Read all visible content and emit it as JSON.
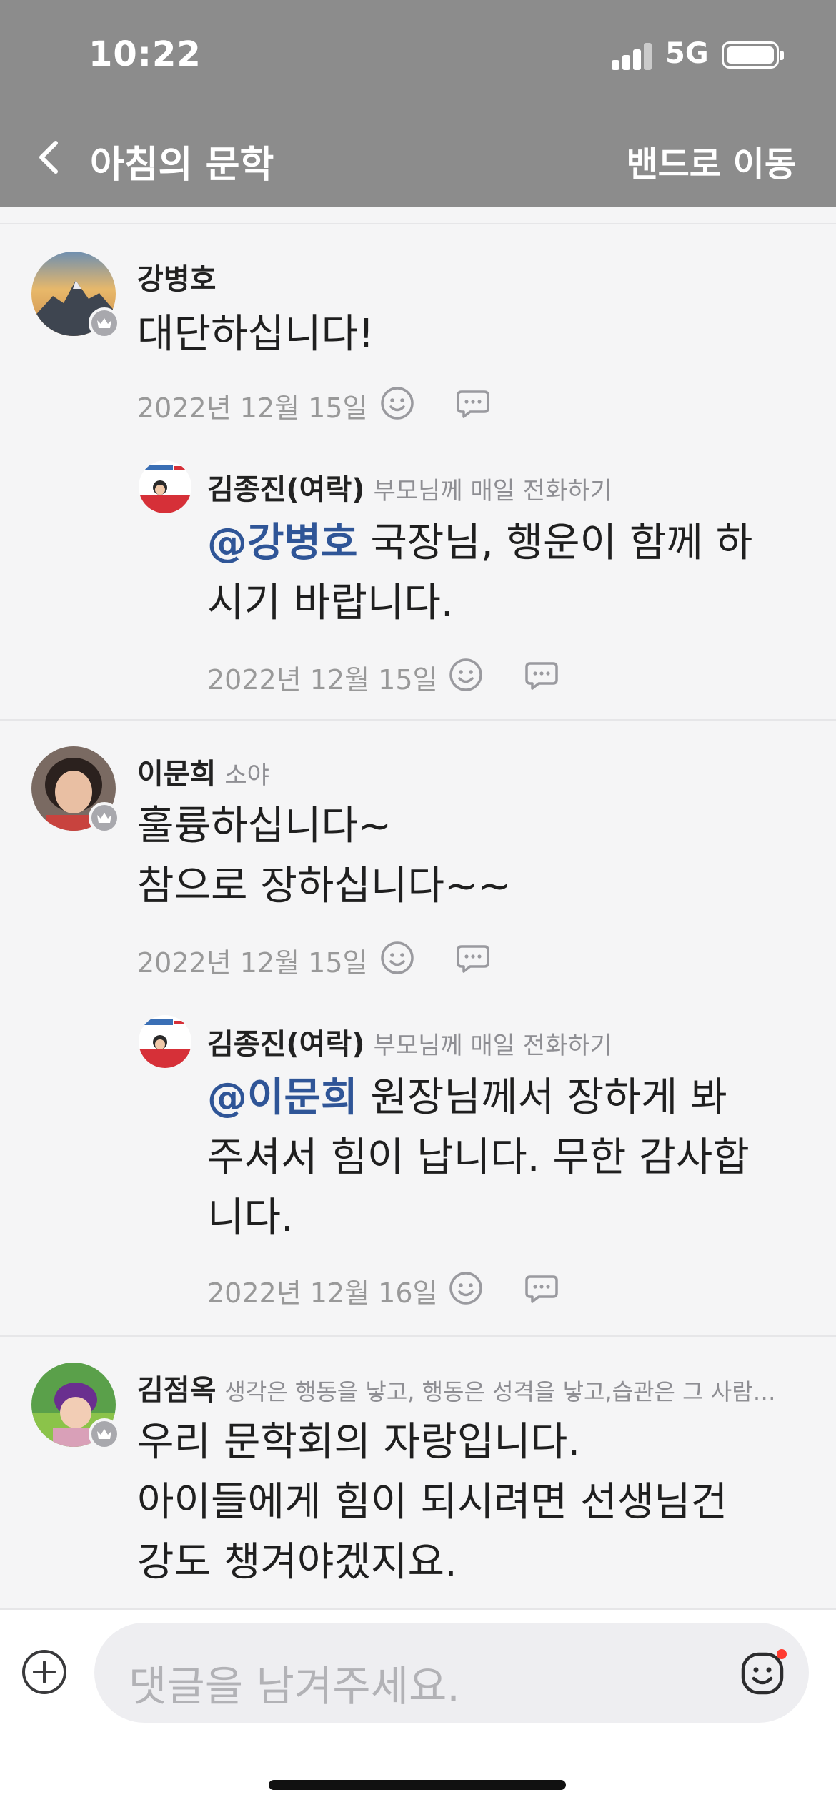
{
  "status_bar": {
    "time": "10:22",
    "network": "5G"
  },
  "nav": {
    "title": "아침의 문학",
    "action": "밴드로 이동"
  },
  "comments": [
    {
      "author": "강병호",
      "description": "",
      "text_lines": [
        "대단하십니다!"
      ],
      "date": "2022년 12월 15일",
      "replies": [
        {
          "author": "김종진(여락)",
          "description": "부모님께 매일 전화하기",
          "mention": "@강병호",
          "text_first": " 국장님, 행운이 함께 하",
          "text_lines": [
            "시기 바랍니다."
          ],
          "date": "2022년 12월 15일"
        }
      ]
    },
    {
      "author": "이문희",
      "description": "소야",
      "text_lines": [
        "훌륭하십니다~",
        "참으로 장하십니다~~"
      ],
      "date": "2022년 12월 15일",
      "replies": [
        {
          "author": "김종진(여락)",
          "description": "부모님께 매일 전화하기",
          "mention": "@이문희",
          "text_first": " 원장님께서 장하게 봐",
          "text_lines": [
            "주셔서 힘이 납니다. 무한 감사합",
            "니다."
          ],
          "date": "2022년 12월 16일"
        }
      ]
    },
    {
      "author": "김점옥",
      "description": "생각은 행동을 낳고, 행동은 성격을 낳고,습관은 그 사람…",
      "text_lines": [
        "우리 문학회의 자랑입니다.",
        "아이들에게 힘이 되시려면 선생님건",
        "강도 챙겨야겠지요."
      ]
    }
  ],
  "input": {
    "placeholder": "댓글을 남겨주세요."
  },
  "icons": {
    "back": "chevron-left-icon",
    "emotion": "smiley-icon",
    "reply": "speech-bubble-icon",
    "badge": "crown-icon",
    "add": "plus-circle-icon",
    "sticker": "sticker-smiley-icon"
  },
  "colors": {
    "header": "#8c8c8c",
    "mention": "#2f5597",
    "notification_dot": "#ff3b30"
  }
}
